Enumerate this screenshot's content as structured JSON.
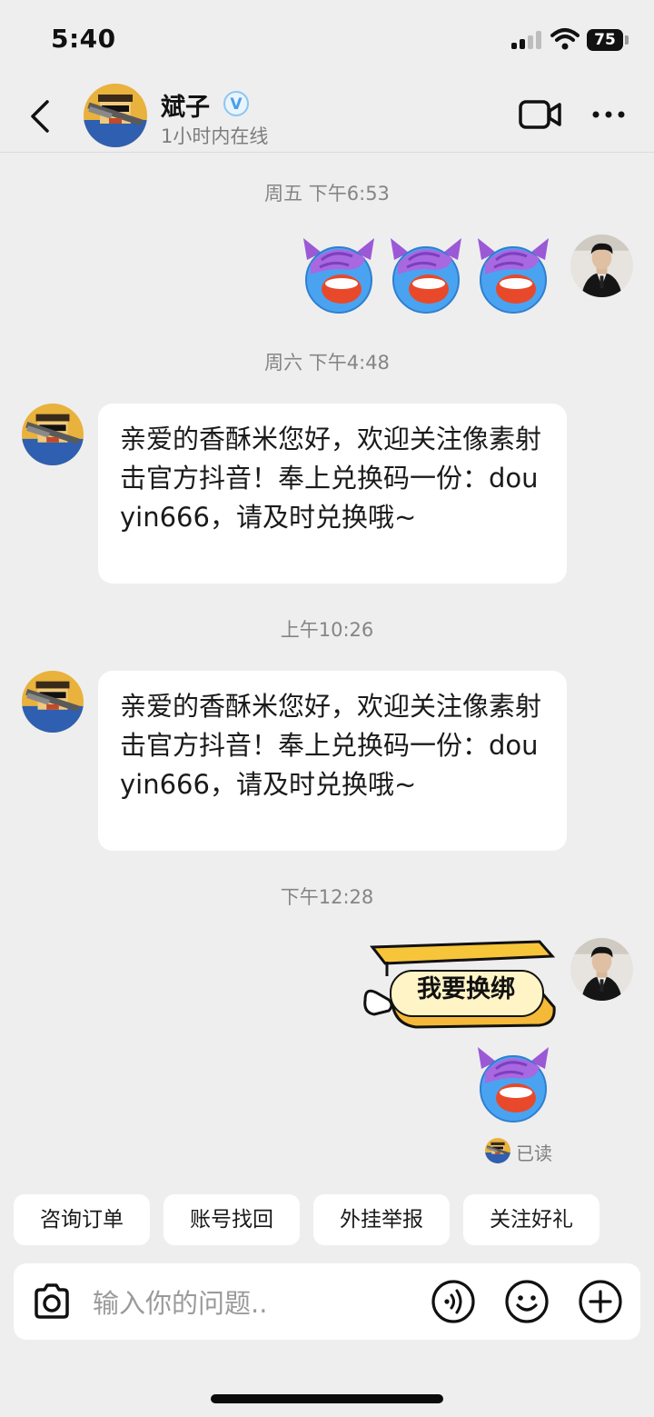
{
  "status_bar": {
    "time": "5:40",
    "battery": "75"
  },
  "header": {
    "contact_name": "斌子",
    "verified_mark": "V",
    "online_status": "1小时内在线",
    "icons": {
      "back": "chevron-left-icon",
      "video": "video-camera-icon",
      "more": "more-dots-icon"
    }
  },
  "messages": [
    {
      "timestamp": "周五 下午6:53",
      "sender": "me",
      "type": "sticker",
      "stickers": [
        "devil-facepalm-emoji",
        "devil-facepalm-emoji",
        "devil-facepalm-emoji"
      ]
    },
    {
      "timestamp": "周六 下午4:48",
      "sender": "contact",
      "type": "text",
      "text": "亲爱的香酥米您好，欢迎关注像素射击官方抖音！奉上兑换码一份：douyin666，请及时兑换哦~"
    },
    {
      "timestamp": "上午10:26",
      "sender": "contact",
      "type": "text",
      "text": "亲爱的香酥米您好，欢迎关注像素射击官方抖音！奉上兑换码一份：douyin666，请及时兑换哦~"
    },
    {
      "timestamp": "下午12:28",
      "sender": "me",
      "type": "sticker",
      "sticker_text": "我要换绑",
      "stickers": [
        "graduation-cap-pointing-sticker",
        "devil-facepalm-emoji"
      ]
    }
  ],
  "read_receipt": "已读",
  "quick_replies": [
    "咨询订单",
    "账号找回",
    "外挂举报",
    "关注好礼"
  ],
  "composer": {
    "placeholder": "输入你的问题..",
    "icons": {
      "camera": "camera-icon",
      "voice": "voice-icon",
      "emoji": "emoji-icon",
      "add": "plus-icon"
    }
  },
  "colors": {
    "background": "#eeeeef",
    "bubble": "#ffffff",
    "verified": "#4a9ee8",
    "sticker_purple": "#9b59d6",
    "sticker_blue": "#4aa3f0"
  }
}
